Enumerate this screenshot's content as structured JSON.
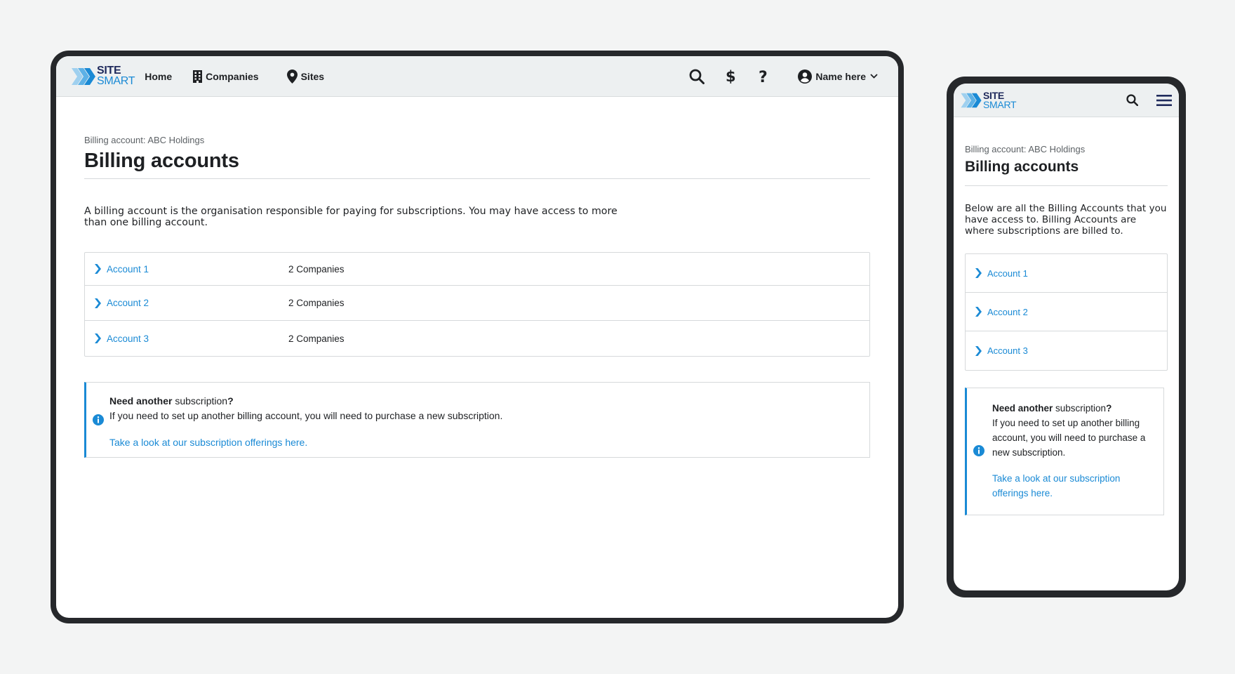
{
  "brand": {
    "line1": "SITE",
    "line2": "SMART",
    "accent": "#1a8ad5",
    "dark": "#1f2a5c"
  },
  "nav": {
    "home": "Home",
    "companies": "Companies",
    "sites": "Sites"
  },
  "user": {
    "name": "Name here"
  },
  "page": {
    "breadcrumb": "Billing account: ABC Holdings",
    "title": "Billing accounts",
    "description_desktop": "A billing account is the organisation responsible for paying for subscriptions. You may have access to more than one billing account.",
    "description_mobile": "Below are all the Billing Accounts that you have access to. Billing Accounts are where subscriptions are billed to."
  },
  "accounts": [
    {
      "name": "Account 1",
      "companies": "2 Companies"
    },
    {
      "name": "Account 2",
      "companies": "2 Companies"
    },
    {
      "name": "Account 3",
      "companies": "2 Companies"
    }
  ],
  "info": {
    "title_bold": "Need another",
    "title_rest": " subscription",
    "title_end": "?",
    "body": "If you need to set up another billing account, you will need to purchase a new subscription.",
    "link": "Take a look at our subscription offerings here."
  },
  "icons": {
    "logo": "chevrons-logo-icon",
    "companies": "building-icon",
    "sites": "map-pin-icon",
    "search": "search-icon",
    "billing": "dollar-icon",
    "help": "question-icon",
    "user": "user-avatar-icon",
    "caret": "chevron-down-icon",
    "menu": "hamburger-menu-icon",
    "row": "chevron-right-icon",
    "info": "info-icon"
  }
}
